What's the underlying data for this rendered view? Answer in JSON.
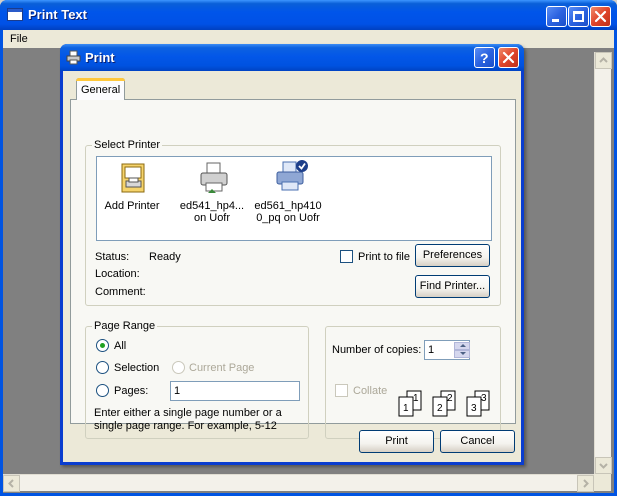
{
  "window": {
    "title": "Print Text",
    "menu": {
      "file": "File"
    }
  },
  "dialog": {
    "title": "Print",
    "tabs": [
      {
        "label": "General"
      }
    ],
    "select_printer": {
      "group_label": "Select Printer",
      "printers": [
        {
          "label_line1": "Add Printer",
          "label_line2": "",
          "selected": false,
          "icon": "add-printer-icon"
        },
        {
          "label_line1": "ed541_hp4...",
          "label_line2": "on Uofr",
          "selected": false,
          "icon": "printer-icon"
        },
        {
          "label_line1": "ed561_hp410",
          "label_line2": "0_pq on Uofr",
          "selected": true,
          "icon": "default-printer-icon"
        }
      ],
      "status_label": "Status:",
      "status_value": "Ready",
      "location_label": "Location:",
      "location_value": "",
      "comment_label": "Comment:",
      "comment_value": "",
      "print_to_file_label": "Print to file",
      "print_to_file_checked": false,
      "preferences_button": "Preferences",
      "find_printer_button": "Find Printer..."
    },
    "page_range": {
      "group_label": "Page Range",
      "all_label": "All",
      "selection_label": "Selection",
      "current_page_label": "Current Page",
      "pages_label": "Pages:",
      "pages_value": "1",
      "selected": "All",
      "hint": "Enter either a single page number or a single page range.  For example, 5-12"
    },
    "copies": {
      "number_label": "Number of copies:",
      "number_value": "1",
      "collate_label": "Collate",
      "collate_checked": false,
      "collate_enabled": false,
      "collate_pages": [
        "1",
        "1",
        "2",
        "2",
        "3",
        "3"
      ]
    },
    "buttons": {
      "print": "Print",
      "cancel": "Cancel"
    }
  },
  "colors": {
    "title_blue": "#0054e3",
    "dialog_face": "#ece9d8",
    "selection_blue": "#316ac5",
    "client_gray": "#808080"
  }
}
